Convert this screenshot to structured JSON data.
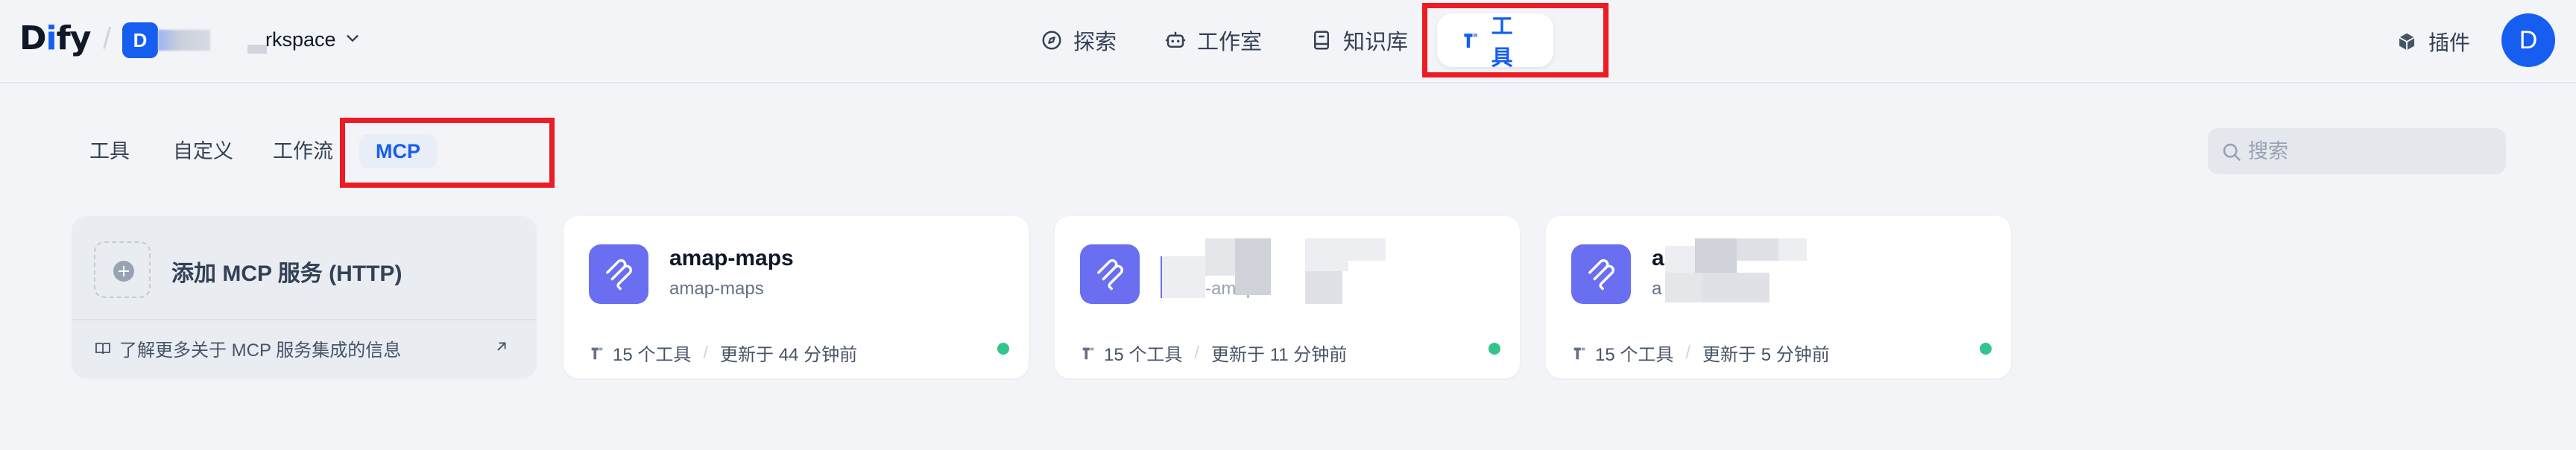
{
  "header": {
    "logo": "Dify",
    "workspace": {
      "avatar": "D",
      "name": "rkspace"
    },
    "nav": [
      {
        "label": "探索",
        "icon": "compass-icon"
      },
      {
        "label": "工作室",
        "icon": "robot-icon"
      },
      {
        "label": "知识库",
        "icon": "book-icon"
      },
      {
        "label": "工具",
        "icon": "tool-icon",
        "active": true
      }
    ],
    "plugins_label": "插件",
    "user_avatar": "D"
  },
  "subtabs": [
    {
      "label": "工具"
    },
    {
      "label": "自定义"
    },
    {
      "label": "工作流"
    },
    {
      "label": "MCP",
      "active": true
    }
  ],
  "search": {
    "placeholder": "搜索"
  },
  "add_card": {
    "title": "添加 MCP 服务 (HTTP)",
    "link": "了解更多关于 MCP 服务集成的信息"
  },
  "cards": [
    {
      "title": "amap-maps",
      "subtitle": "amap-maps",
      "tools": "15 个工具",
      "updated": "更新于 44 分钟前",
      "status_color": "#31c48d"
    },
    {
      "title": "",
      "subtitle": "amap-amap",
      "tools": "15 个工具",
      "updated": "更新于 11 分钟前",
      "status_color": "#31c48d"
    },
    {
      "title": "a",
      "subtitle": "a",
      "tools": "15 个工具",
      "updated": "更新于 5 分钟前",
      "status_color": "#31c48d"
    }
  ],
  "colors": {
    "accent": "#155eef",
    "highlight": "#ec1b24",
    "mcp_icon_bg": "#6a6ef0"
  }
}
